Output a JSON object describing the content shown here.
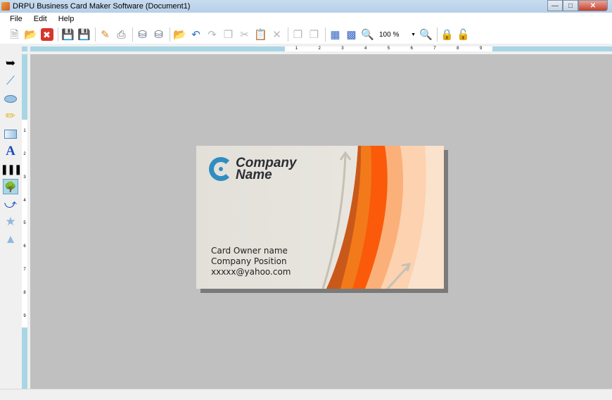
{
  "window": {
    "title": "DRPU Business Card Maker Software  (Document1)"
  },
  "menu": [
    "File",
    "Edit",
    "Help"
  ],
  "toolbar": {
    "zoom_value": "100 %"
  },
  "ruler": {
    "h_labels": [
      "1",
      "2",
      "3",
      "4",
      "5",
      "6",
      "7",
      "8",
      "9"
    ],
    "v_labels": [
      "1",
      "2",
      "3",
      "4",
      "5",
      "6",
      "7",
      "8",
      "9"
    ]
  },
  "card": {
    "company_line1": "Company",
    "company_line2": "Name",
    "owner": "Card Owner name",
    "position": "Company Position",
    "email": "xxxxx@yahoo.com"
  }
}
